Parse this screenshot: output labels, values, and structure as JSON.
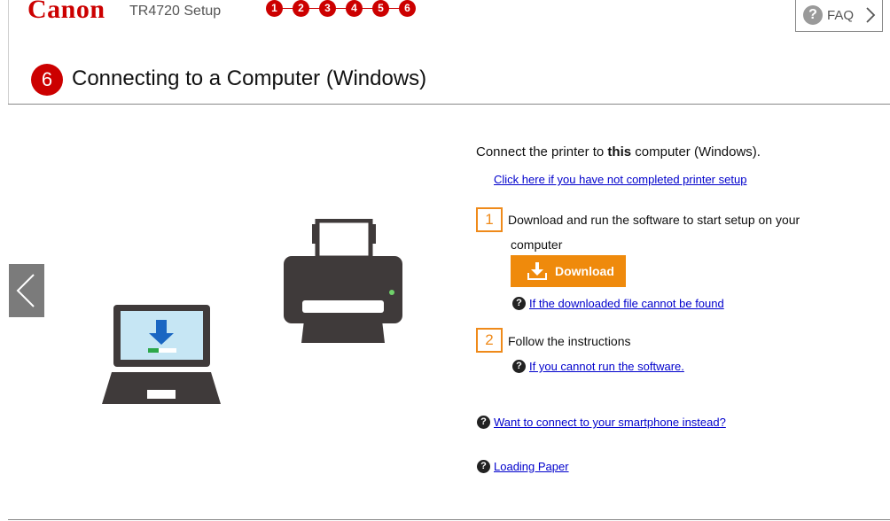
{
  "header": {
    "brand": "Canon",
    "model_setup": "TR4720 Setup",
    "steps": [
      "1",
      "2",
      "3",
      "4",
      "5",
      "6"
    ],
    "faq_label": "FAQ"
  },
  "page": {
    "step_number": "6",
    "title": "Connecting to a Computer (Windows)"
  },
  "content": {
    "intro_before": "Connect the printer to ",
    "intro_bold": "this",
    "intro_after": " computer (Windows).",
    "setup_link": "Click here if you have not completed printer setup",
    "step1": {
      "number": "1",
      "text_line1": "Download and run the software to start setup on your",
      "text_line2": "computer"
    },
    "download_label": "Download",
    "help_file_not_found": "If the downloaded file cannot be found",
    "step2": {
      "number": "2",
      "text": "Follow the instructions"
    },
    "help_cannot_run": "If you cannot run the software.",
    "smartphone_link": "Want to connect to your smartphone instead?",
    "loading_paper_link": "Loading Paper"
  },
  "icons": {
    "help": "question-circle-icon",
    "download": "download-arrow-icon",
    "faq_chevron": "chevron-right-icon",
    "prev": "chevron-left-icon"
  },
  "colors": {
    "brand_red": "#cc0000",
    "accent_orange": "#ef8a0c",
    "link_blue": "#0000cc"
  }
}
